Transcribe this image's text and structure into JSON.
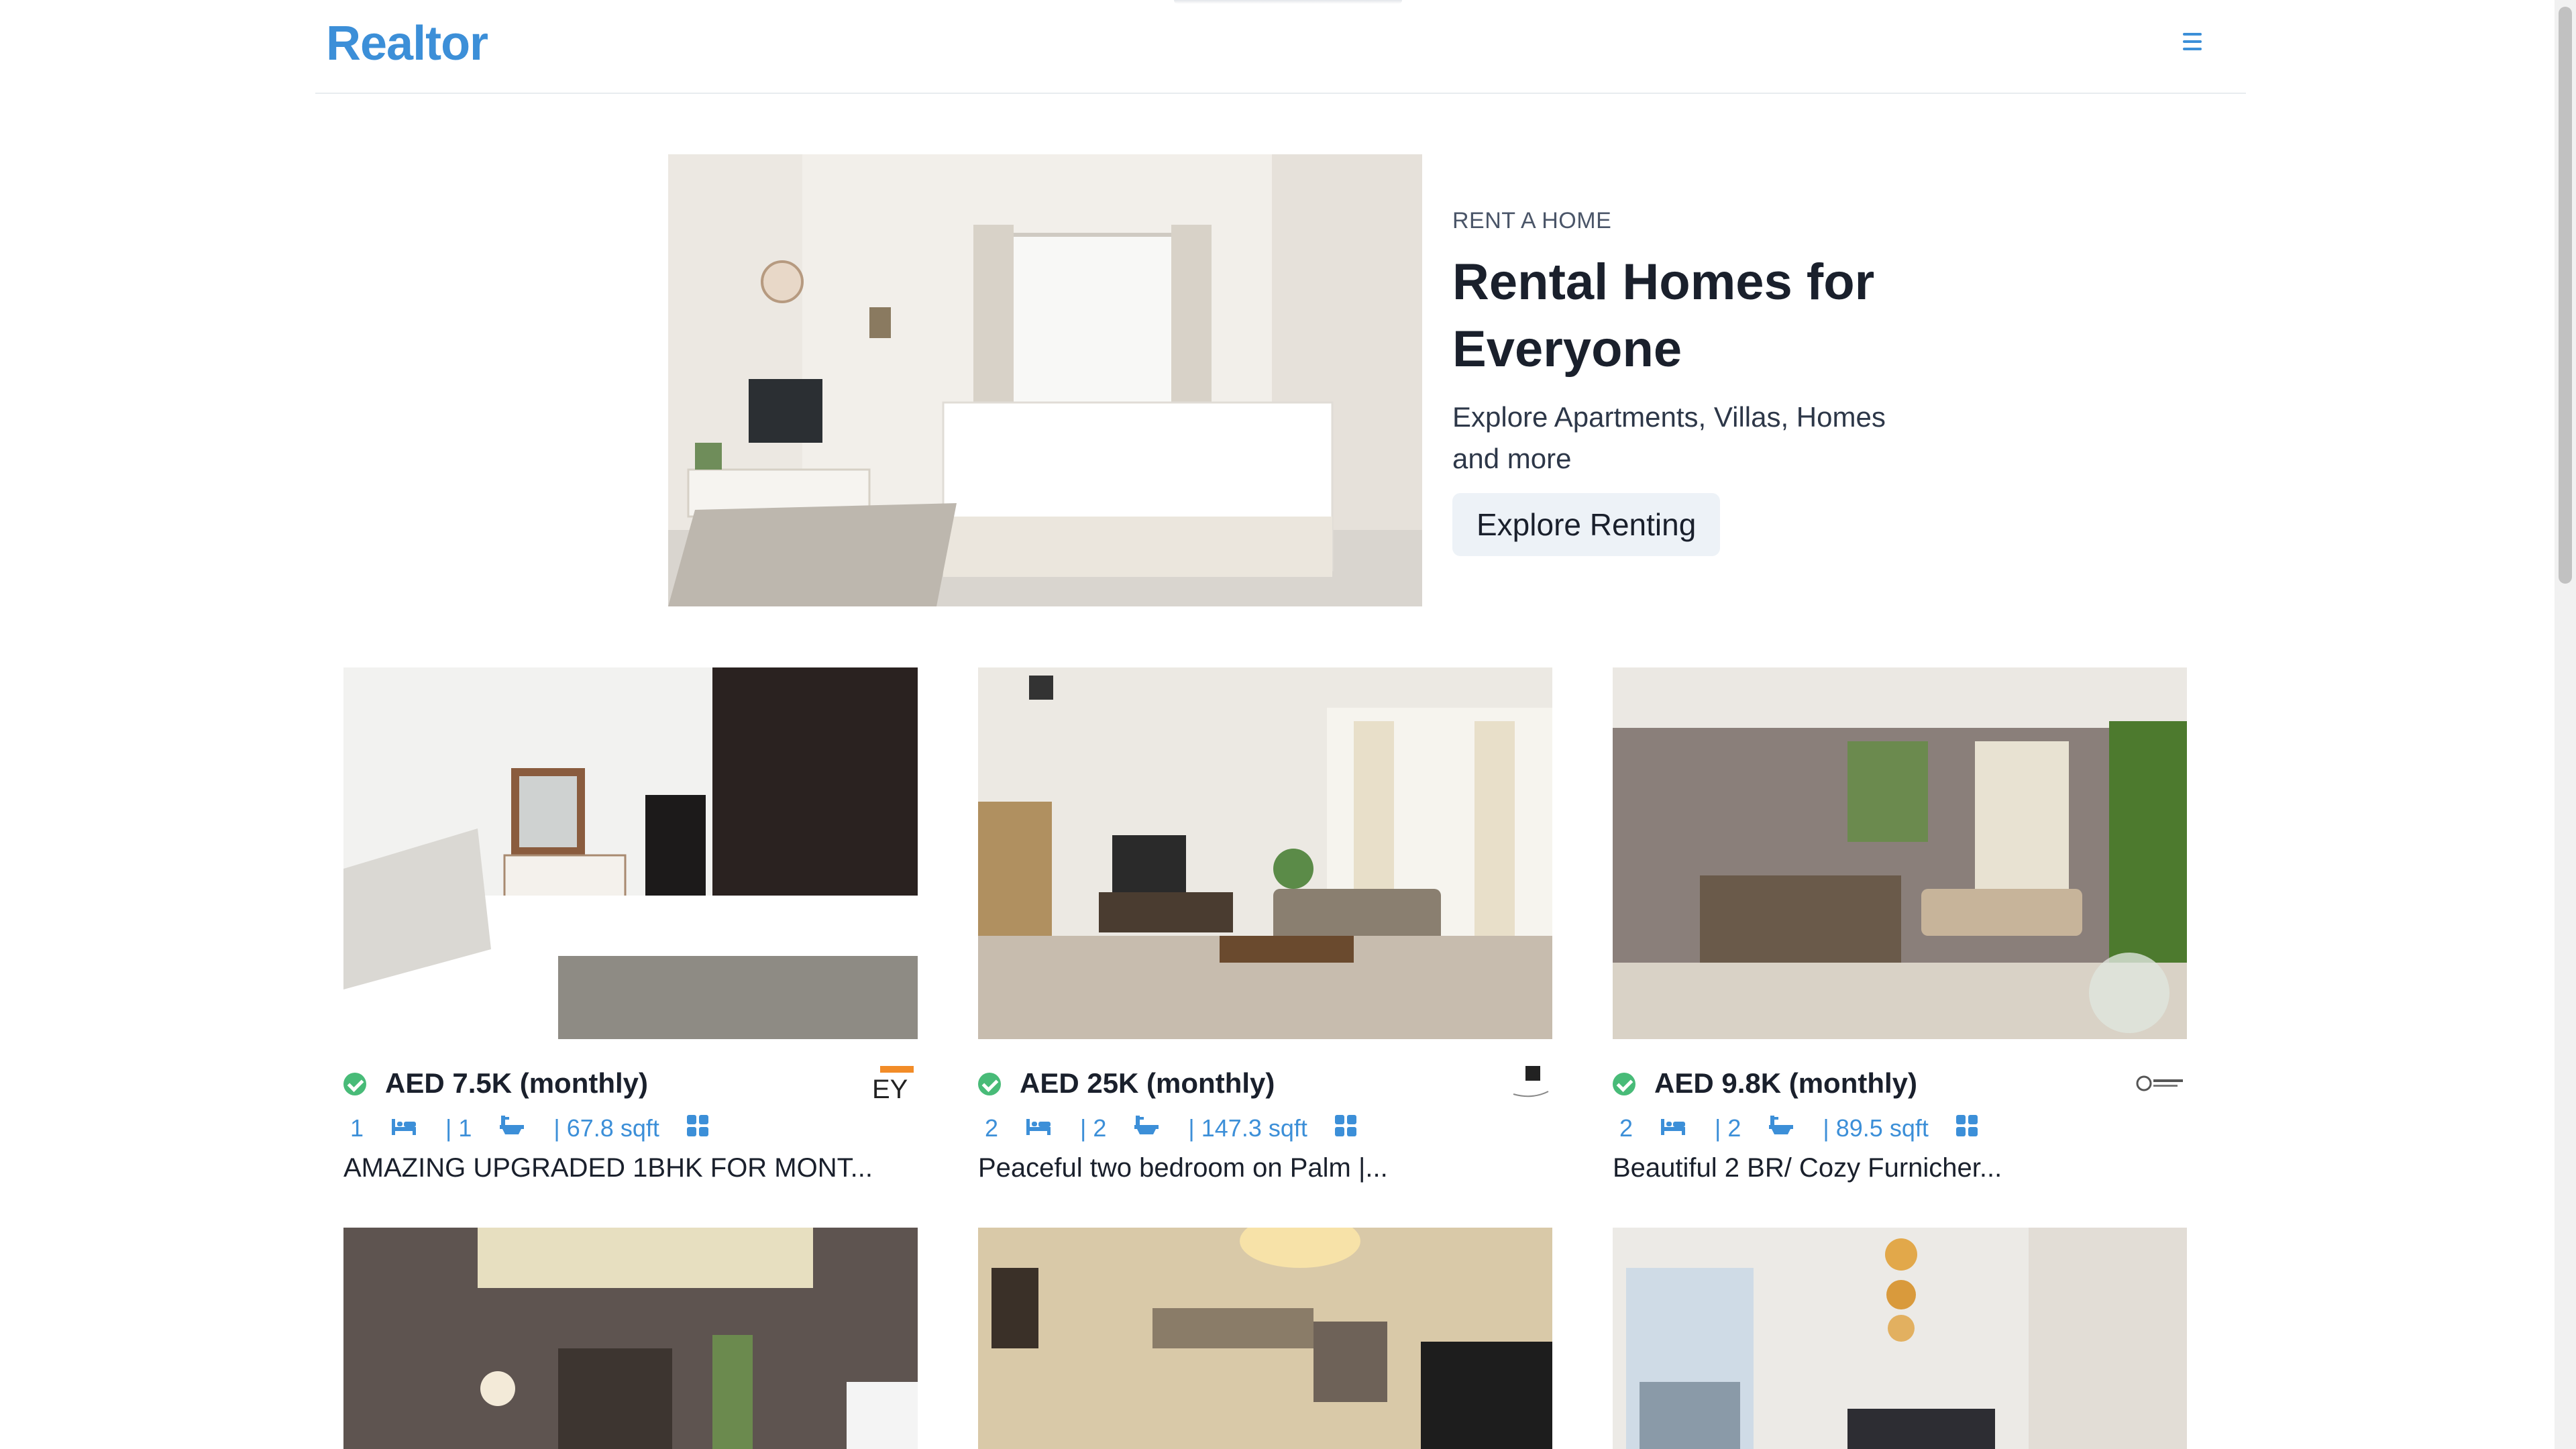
{
  "header": {
    "logo": "Realtor",
    "menu_icon": "hamburger-icon"
  },
  "hero": {
    "eyebrow": "RENT A HOME",
    "title": "Rental Homes for Everyone",
    "subtitle": "Explore Apartments, Villas, Homes and more",
    "button_label": "Explore Renting"
  },
  "colors": {
    "accent": "#3c8fd8",
    "verified": "#48bb78",
    "button_bg": "#edf2f7"
  },
  "listings": [
    {
      "price": "AED 7.5K (monthly)",
      "rooms": "1",
      "baths": "| 1",
      "area": "| 67.8 sqft",
      "title": "AMAZING UPGRADED 1BHK FOR MONT...",
      "agency_logo": "EY"
    },
    {
      "price": "AED 25K (monthly)",
      "rooms": "2",
      "baths": "| 2",
      "area": "| 147.3 sqft",
      "title": "Peaceful two bedroom on Palm |...",
      "agency_logo": "holiday-homes-logo"
    },
    {
      "price": "AED 9.8K (monthly)",
      "rooms": "2",
      "baths": "| 2",
      "area": "| 89.5 sqft",
      "title": "Beautiful 2 BR/ Cozy Furnicher...",
      "agency_logo": "holiday-boulevard-logo"
    },
    {
      "photo": "living-room-photo"
    },
    {
      "photo": "living-room-photo"
    },
    {
      "photo": "bedroom-photo"
    }
  ]
}
